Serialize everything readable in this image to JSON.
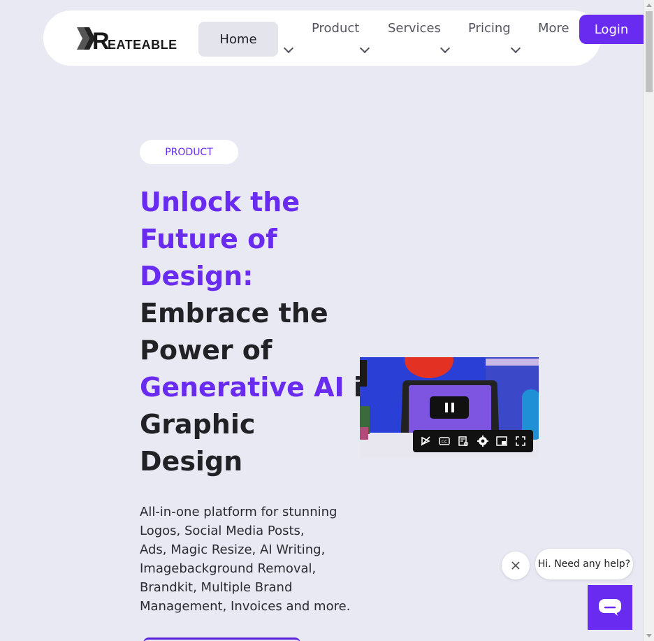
{
  "header": {
    "logo_text": "KREATEABLE",
    "nav": [
      {
        "label": "Home"
      },
      {
        "label": "Product"
      },
      {
        "label": "Services"
      },
      {
        "label": "Pricing"
      },
      {
        "label": "More"
      }
    ],
    "login_label": "Login"
  },
  "hero": {
    "badge": "PRODUCT",
    "title_lines": [
      {
        "text": "Unlock the",
        "accent": true
      },
      {
        "text": "Future of",
        "accent": true
      },
      {
        "text": "Design:",
        "accent": true
      },
      {
        "text": "Embrace the",
        "accent": false
      },
      {
        "text": "Power of",
        "accent": false
      },
      {
        "accent_part": "Generative AI",
        "rest": " in"
      },
      {
        "text": "Graphic",
        "accent": false
      },
      {
        "text": "Design",
        "accent": false
      }
    ],
    "description_lines": [
      "All-in-one platform for stunning",
      "Logos, Social Media Posts,",
      "Ads, Magic Resize, AI Writing,",
      "Imagebackground Removal,",
      "Brandkit, Multiple Brand",
      "Management, Invoices and more."
    ]
  },
  "video": {
    "controls": [
      "autoplay-off-icon",
      "captions-icon",
      "transcript-icon",
      "settings-icon",
      "miniplayer-icon",
      "fullscreen-icon"
    ]
  },
  "chat": {
    "prompt": "Hi. Need any help?"
  },
  "colors": {
    "accent": "#6a2bf0",
    "background": "#e9e9f3",
    "text_dark": "#222226"
  }
}
